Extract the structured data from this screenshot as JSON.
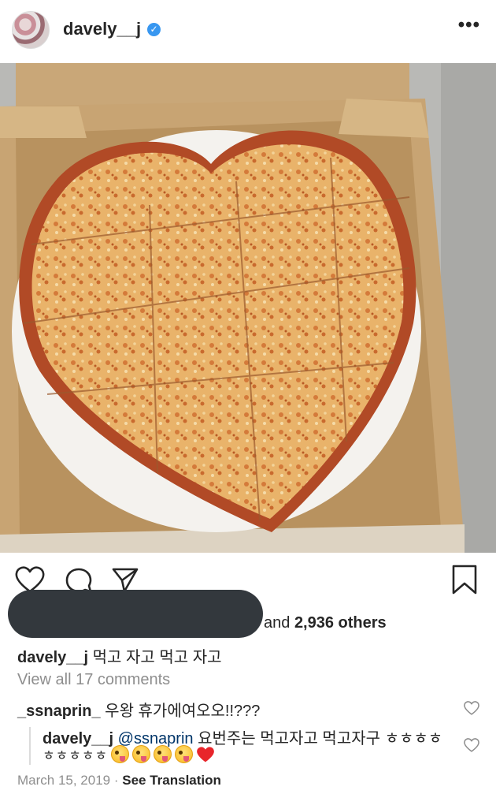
{
  "post": {
    "username": "davely__j",
    "more_icon": "more-icon",
    "verified_icon": "verified-badge-icon"
  },
  "actions": {
    "like_icon": "heart-icon",
    "comment_icon": "comment-icon",
    "share_icon": "send-icon",
    "save_icon": "bookmark-icon"
  },
  "likes": {
    "prefix": "and ",
    "count": "2,936 others"
  },
  "caption": {
    "username": "davely__j",
    "text": " 먹고 자고 먹고 자고"
  },
  "comments": {
    "view_all": "View all 17 comments",
    "items": [
      {
        "username": "_ssnaprin_",
        "text": " 우왕 휴가에여오오!!???"
      },
      {
        "username": "davely__j",
        "mention": " @ssnaprin",
        "text": " 요번주는 먹고자고 먹고자구 ㅎㅎㅎㅎ",
        "text2": "ㅎㅎㅎㅎㅎ"
      }
    ]
  },
  "footer": {
    "date": "March 15, 2019",
    "separator": " · ",
    "translation": "See Translation"
  },
  "colors": {
    "accent": "#3897f0",
    "text": "#262626",
    "muted": "#8e8e8e",
    "heart_red": "#ed4956"
  }
}
